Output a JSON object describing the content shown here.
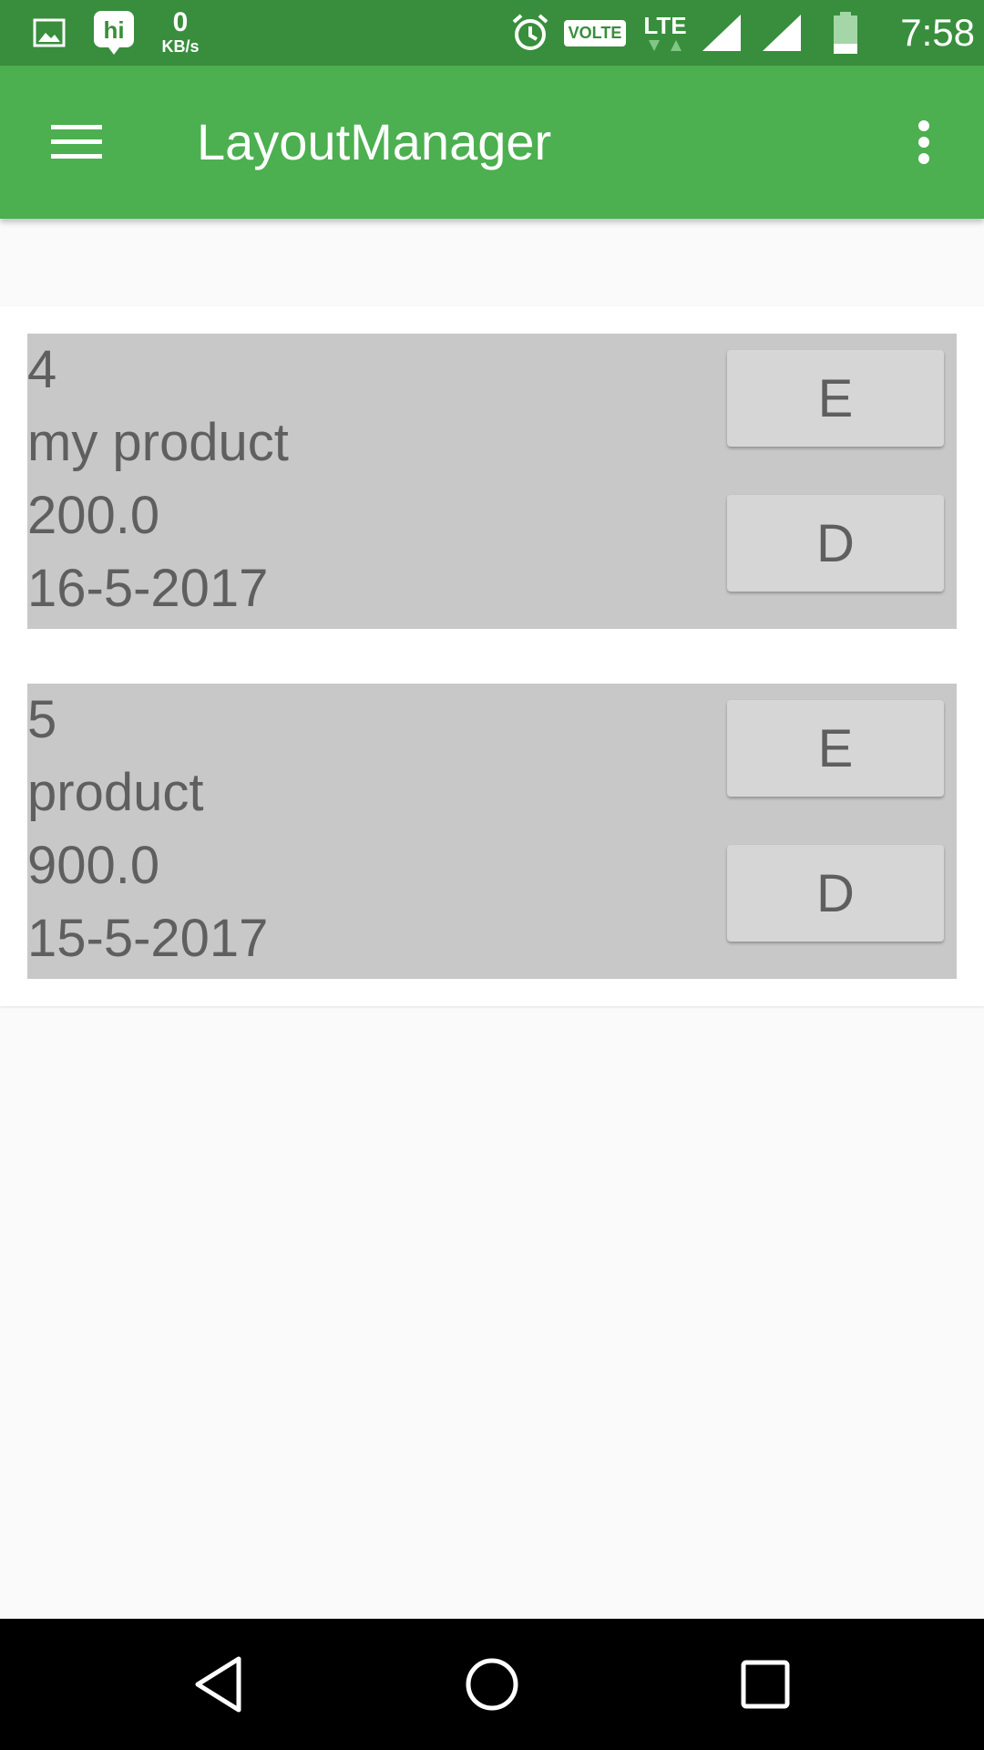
{
  "status_bar": {
    "net_speed_value": "0",
    "net_speed_unit": "KB/s",
    "volte_label": "VOLTE",
    "lte_label": "LTE",
    "time": "7:58",
    "icons": [
      "image-icon",
      "hike-app-icon",
      "alarm-icon",
      "volte-icon",
      "lte-icon",
      "signal-icon",
      "signal-icon",
      "battery-icon"
    ]
  },
  "app_bar": {
    "title": "LayoutManager",
    "menu_icon": "hamburger-menu-icon",
    "overflow_icon": "more-vert-icon"
  },
  "products": [
    {
      "id": "4",
      "name": "my product",
      "price": "200.0",
      "date": "16-5-2017",
      "edit_label": "E",
      "delete_label": "D"
    },
    {
      "id": "5",
      "name": "product",
      "price": "900.0",
      "date": "15-5-2017",
      "edit_label": "E",
      "delete_label": "D"
    }
  ],
  "nav_bar": {
    "icons": [
      "back-icon",
      "home-icon",
      "recents-icon"
    ]
  },
  "colors": {
    "status_bar": "#388e3c",
    "app_bar": "#4caf50",
    "card_inner": "#c8c8c8",
    "button": "#d6d6d6",
    "text": "#5f5f5f"
  }
}
